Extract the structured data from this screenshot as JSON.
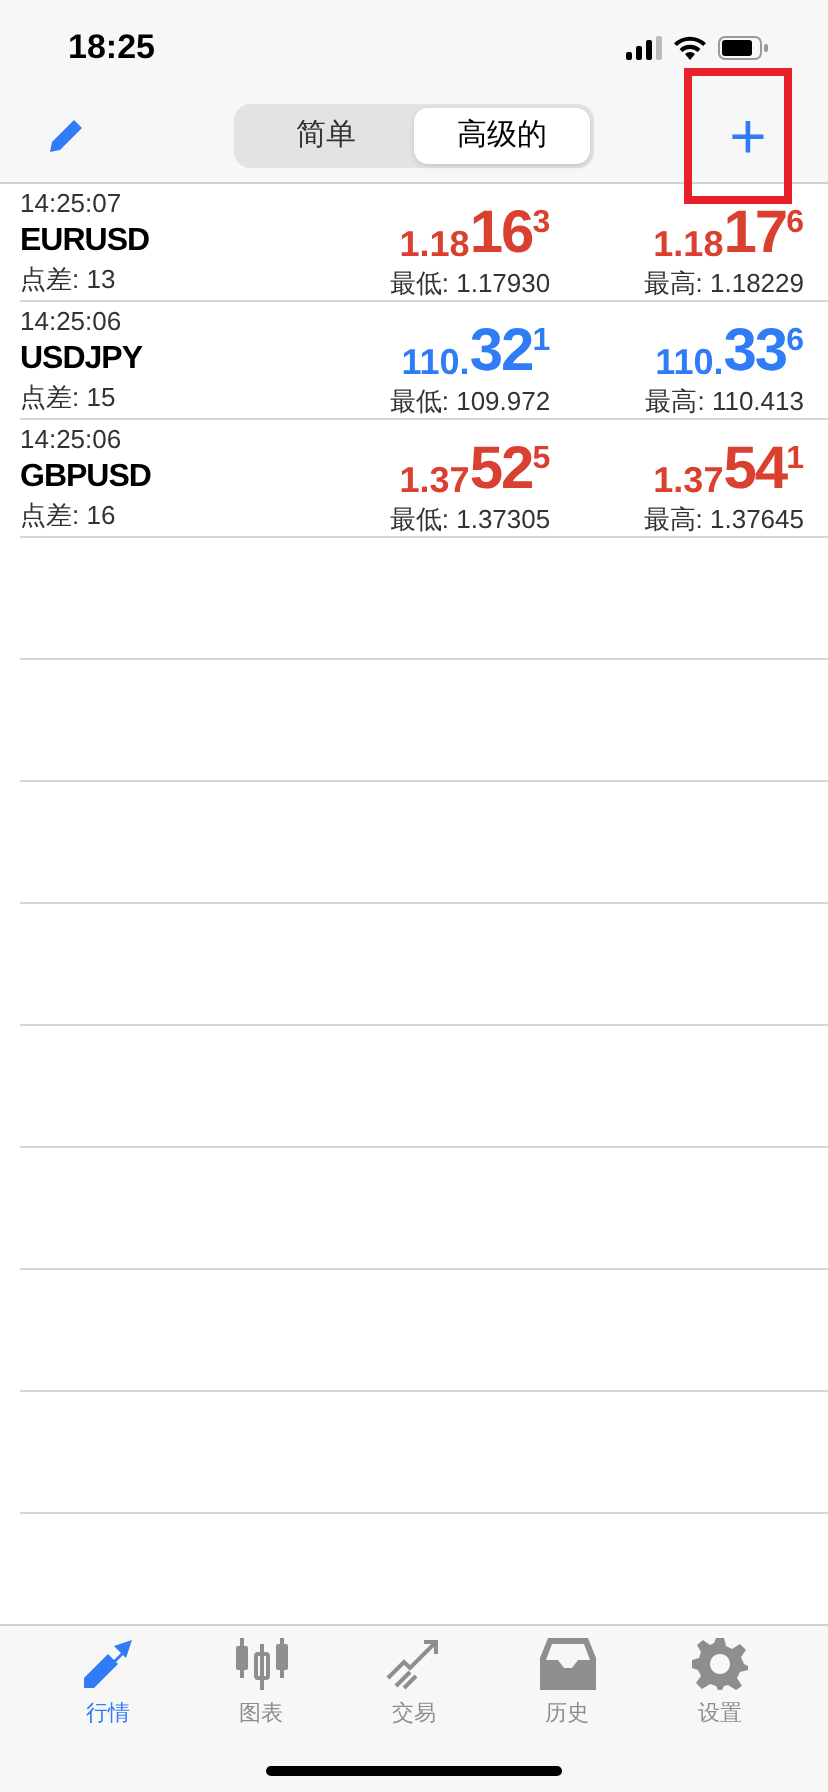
{
  "status_bar": {
    "time": "18:25"
  },
  "segments": [
    {
      "label": "简单",
      "selected": false
    },
    {
      "label": "高级的",
      "selected": true
    }
  ],
  "add_button": {
    "label": "+",
    "highlighted": true
  },
  "quotes": [
    {
      "time": "14:25:07",
      "symbol": "EURUSD",
      "spread": "点差: 13",
      "color": "#d9402f",
      "bid": {
        "head": "1.18",
        "big": "16",
        "tail": "3"
      },
      "low": "最低: 1.17930",
      "ask": {
        "head": "1.18",
        "big": "17",
        "tail": "6"
      },
      "high": "最高: 1.18229"
    },
    {
      "time": "14:25:06",
      "symbol": "USDJPY",
      "spread": "点差: 15",
      "color": "#2f7cf6",
      "bid": {
        "head": "110.",
        "big": "32",
        "tail": "1"
      },
      "low": "最低: 109.972",
      "ask": {
        "head": "110.",
        "big": "33",
        "tail": "6"
      },
      "high": "最高: 110.413"
    },
    {
      "time": "14:25:06",
      "symbol": "GBPUSD",
      "spread": "点差: 16",
      "color": "#d9402f",
      "bid": {
        "head": "1.37",
        "big": "52",
        "tail": "5"
      },
      "low": "最低: 1.37305",
      "ask": {
        "head": "1.37",
        "big": "54",
        "tail": "1"
      },
      "high": "最高: 1.37645"
    }
  ],
  "tab_bar": [
    {
      "kind": "quotes",
      "label": "行情",
      "selected": true
    },
    {
      "kind": "chart",
      "label": "图表",
      "selected": false
    },
    {
      "kind": "trade",
      "label": "交易",
      "selected": false
    },
    {
      "kind": "history",
      "label": "历史",
      "selected": false
    },
    {
      "kind": "settings",
      "label": "设置",
      "selected": false
    }
  ]
}
